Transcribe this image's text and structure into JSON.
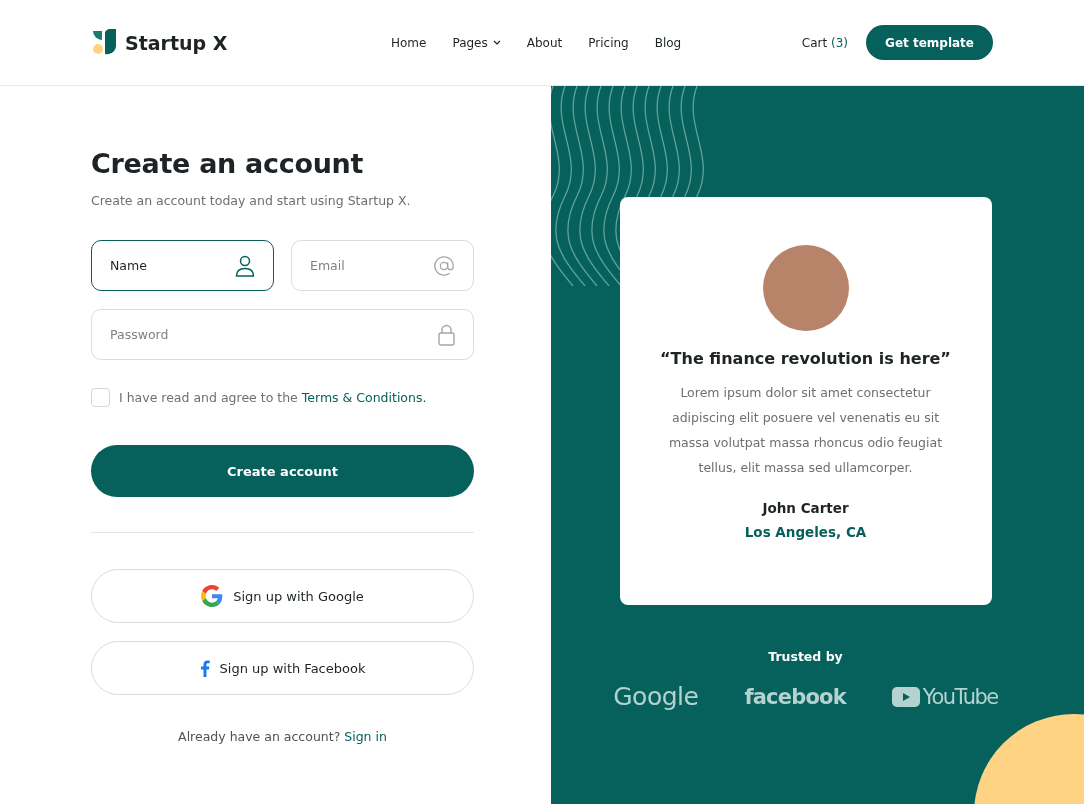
{
  "header": {
    "brand": "Startup X",
    "nav": [
      {
        "label": "Home",
        "dropdown": false
      },
      {
        "label": "Pages",
        "dropdown": true
      },
      {
        "label": "About",
        "dropdown": false
      },
      {
        "label": "Pricing",
        "dropdown": false
      },
      {
        "label": "Blog",
        "dropdown": false
      }
    ],
    "cart": {
      "label": "Cart",
      "count": "(3)"
    },
    "cta": "Get template"
  },
  "form": {
    "title": "Create an account",
    "subtitle": "Create an account today and start using Startup X.",
    "fields": [
      {
        "kind": "name",
        "placeholder": "Name",
        "focused": true
      },
      {
        "kind": "email",
        "placeholder": "Email",
        "focused": false
      },
      {
        "kind": "password",
        "placeholder": "Password",
        "focused": false
      }
    ],
    "terms": {
      "checked": false,
      "text": "I have read and agree to the",
      "link": "Terms & Conditions."
    },
    "submit": "Create account",
    "social": [
      {
        "kind": "google",
        "label": "Sign up with Google"
      },
      {
        "kind": "facebook",
        "label": "Sign up with Facebook"
      }
    ],
    "signin": {
      "text": "Already have an account?",
      "link": "Sign in"
    }
  },
  "testimonial": {
    "quote": "“The finance revolution is here”",
    "body": "Lorem ipsum dolor sit amet consectetur adipiscing elit posuere vel venenatis eu sit massa volutpat massa rhoncus odio feugiat tellus, elit massa sed ullamcorper.",
    "name": "John Carter",
    "location": "Los Angeles, CA"
  },
  "trusted": {
    "title": "Trusted by",
    "logos": [
      {
        "kind": "google",
        "label": "Google"
      },
      {
        "kind": "facebook",
        "label": "facebook"
      },
      {
        "kind": "youtube",
        "label": "YouTube"
      }
    ]
  }
}
